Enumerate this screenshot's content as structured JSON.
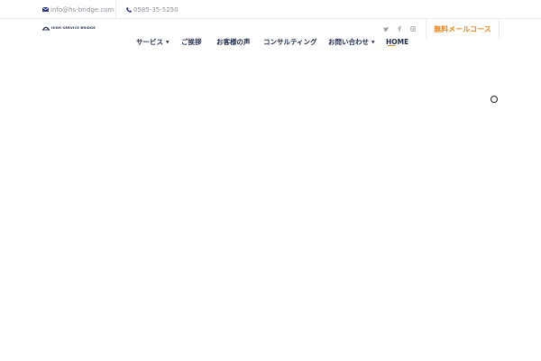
{
  "topbar": {
    "email": "info@hs-bridge.com",
    "phone": "0585-35-5250"
  },
  "logo": {
    "text": "HIGH SERVICE BRIDGE"
  },
  "nav": {
    "items": [
      {
        "label": "サービス"
      },
      {
        "label": "ご挨拶"
      },
      {
        "label": "お客様の声"
      },
      {
        "label": "コンサルティング"
      },
      {
        "label": "お問い合わせ"
      },
      {
        "label": "HOME"
      }
    ],
    "active": "HOME"
  },
  "social": {
    "icons": [
      "twitter-icon",
      "facebook-icon",
      "instagram-icon"
    ]
  },
  "cta": {
    "label": "無料メールコース"
  },
  "colors": {
    "accent": "#f0841a",
    "navy": "#1e2a4a",
    "muted": "#8a8f9c"
  }
}
